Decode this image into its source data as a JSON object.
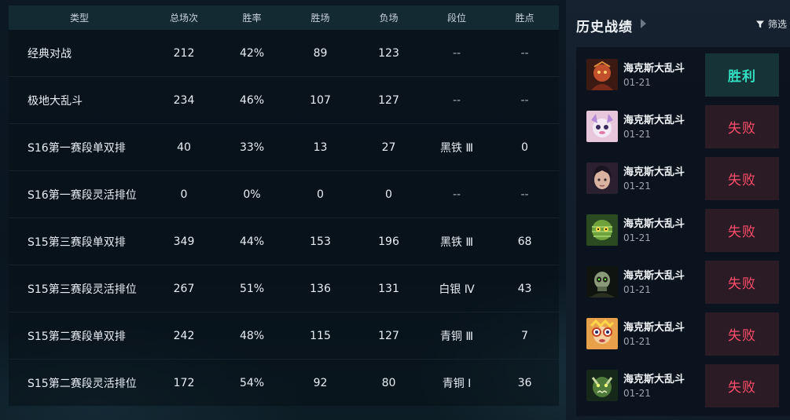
{
  "stats_table": {
    "headers": [
      "类型",
      "总场次",
      "胜率",
      "胜场",
      "负场",
      "段位",
      "胜点"
    ],
    "rows": [
      [
        "经典对战",
        "212",
        "42%",
        "89",
        "123",
        "--",
        "--"
      ],
      [
        "极地大乱斗",
        "234",
        "46%",
        "107",
        "127",
        "--",
        "--"
      ],
      [
        "S16第一赛段单双排",
        "40",
        "33%",
        "13",
        "27",
        "黑铁 Ⅲ",
        "0"
      ],
      [
        "S16第一赛段灵活排位",
        "0",
        "0%",
        "0",
        "0",
        "--",
        "--"
      ],
      [
        "S15第三赛段单双排",
        "349",
        "44%",
        "153",
        "196",
        "黑铁 Ⅲ",
        "68"
      ],
      [
        "S15第三赛段灵活排位",
        "267",
        "51%",
        "136",
        "131",
        "白银 Ⅳ",
        "43"
      ],
      [
        "S15第二赛段单双排",
        "242",
        "48%",
        "115",
        "127",
        "青铜 Ⅲ",
        "7"
      ],
      [
        "S15第二赛段灵活排位",
        "172",
        "54%",
        "92",
        "80",
        "青铜 Ⅰ",
        "36"
      ]
    ]
  },
  "history": {
    "title": "历史战绩",
    "filter_label": "筛选",
    "icons": {
      "expand": "chevron-right-icon",
      "filter": "filter-funnel-icon"
    },
    "colors": {
      "win": "#33e0c4",
      "lose": "#ff4d6b"
    },
    "matches": [
      {
        "mode": "海克斯大乱斗",
        "date": "01-21",
        "result": "胜利",
        "outcome": "win",
        "champion_icon": "champion-portrait-red-armored"
      },
      {
        "mode": "海克斯大乱斗",
        "date": "01-21",
        "result": "失败",
        "outcome": "lose",
        "champion_icon": "champion-portrait-pink-yordle"
      },
      {
        "mode": "海克斯大乱斗",
        "date": "01-21",
        "result": "失败",
        "outcome": "lose",
        "champion_icon": "champion-portrait-dark-haired"
      },
      {
        "mode": "海克斯大乱斗",
        "date": "01-21",
        "result": "失败",
        "outcome": "lose",
        "champion_icon": "champion-portrait-green-mummy"
      },
      {
        "mode": "海克斯大乱斗",
        "date": "01-21",
        "result": "失败",
        "outcome": "lose",
        "champion_icon": "champion-portrait-skull"
      },
      {
        "mode": "海克斯大乱斗",
        "date": "01-21",
        "result": "失败",
        "outcome": "lose",
        "champion_icon": "champion-portrait-yordle-gunner"
      },
      {
        "mode": "海克斯大乱斗",
        "date": "01-21",
        "result": "失败",
        "outcome": "lose",
        "champion_icon": "champion-portrait-green-beast"
      }
    ]
  }
}
